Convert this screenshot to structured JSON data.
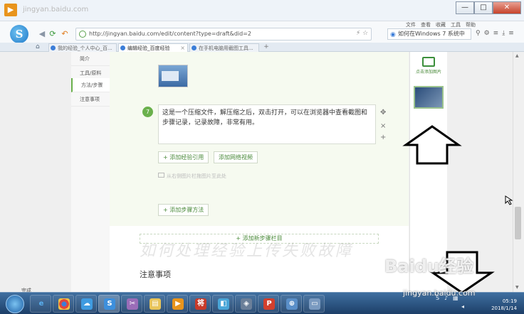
{
  "window": {
    "title": "jingyan.baidu.com",
    "controls": [
      "—",
      "□",
      "✕"
    ]
  },
  "toolbar": {
    "url": "http://jingyan.baidu.com/edit/content?type=draft&did=2",
    "menu_links": [
      "文件",
      "查看",
      "收藏",
      "工具",
      "帮助"
    ],
    "search_text": "如何在Windows 7 系统中"
  },
  "tabs": [
    {
      "label": "我的经验_个人中心_百..."
    },
    {
      "label": "编辑经验_百度经验"
    },
    {
      "label": "在手机电脑用截图工具..."
    }
  ],
  "left_menu": [
    "简介",
    "工具/原料",
    "方法/步骤",
    "注意事项"
  ],
  "editor": {
    "step_number": "7",
    "step_text": "这是一个压缩文件，解压缩之后，双击打开，可以在浏览器中查看截图和步骤记录，记录故障，非常有用。",
    "add_reference": "+ 添加经验引用",
    "add_video": "添加网络视频",
    "upload_hint": "从右侧图片栏拖图片至此处",
    "add_method": "+ 添加步骤方法",
    "add_section": "+ 添加新步骤栏目",
    "watermark": "如何处理经验上传失败故障",
    "notes_title": "注意事项"
  },
  "right_panel": {
    "upload_button": "点击添加图片"
  },
  "status": {
    "text": "完成"
  },
  "taskbar": {
    "clock_time": "05:19",
    "clock_date": "2018/1/14",
    "watermark": "Baidu经验",
    "watermark_sub": "jingyan.baidu.com"
  }
}
